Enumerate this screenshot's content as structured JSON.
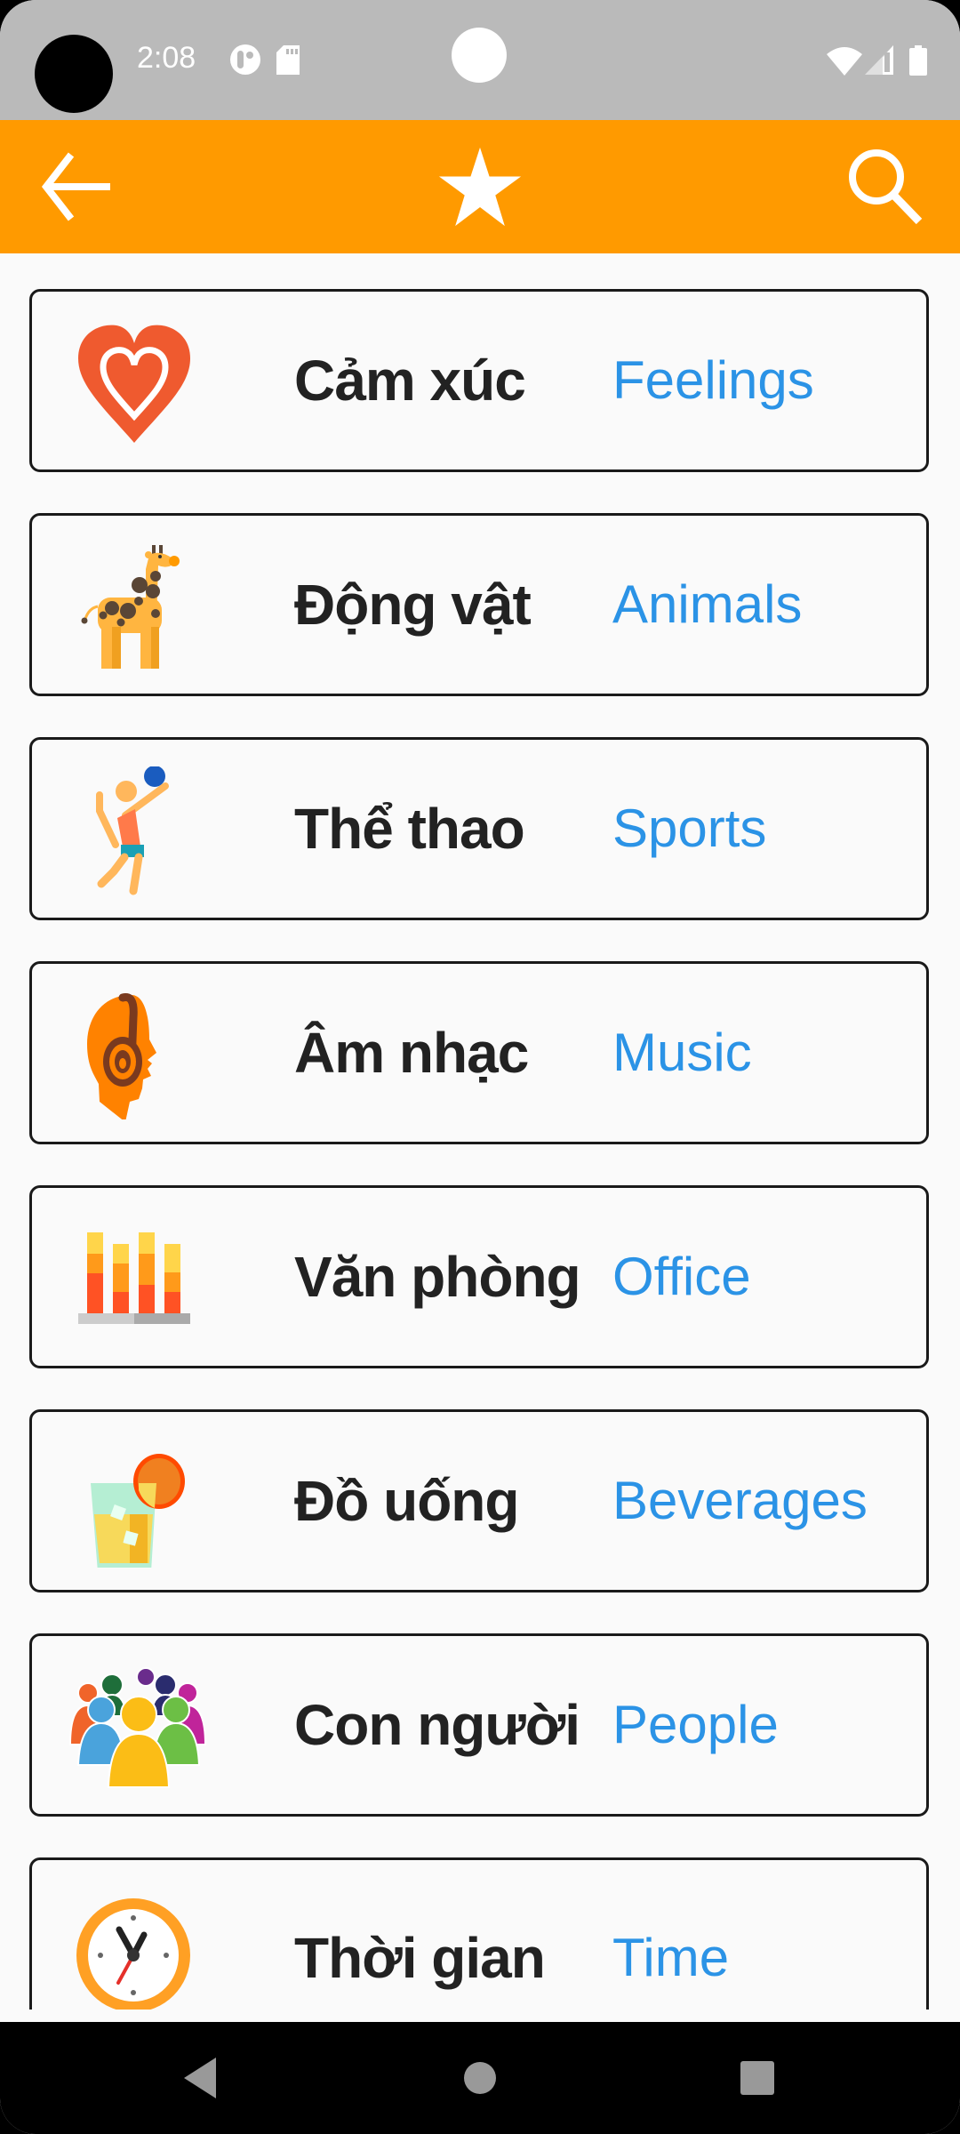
{
  "status_bar": {
    "time": "2:08",
    "left_icons": [
      "notification-app-icon",
      "sd-card-icon"
    ],
    "right_icons": [
      "wifi-icon",
      "cell-signal-icon",
      "battery-icon"
    ]
  },
  "app_bar": {
    "back_icon": "arrow-left-icon",
    "center_icon": "star-icon",
    "search_icon": "search-icon",
    "background_color": "#ff9a00"
  },
  "categories": [
    {
      "vi": "Cảm xúc",
      "en": "Feelings",
      "icon": "heart-icon"
    },
    {
      "vi": "Động vật",
      "en": "Animals",
      "icon": "giraffe-icon"
    },
    {
      "vi": "Thể thao",
      "en": "Sports",
      "icon": "volleyball-player-icon"
    },
    {
      "vi": "Âm nhạc",
      "en": "Music",
      "icon": "headphones-head-icon"
    },
    {
      "vi": "Văn phòng",
      "en": "Office",
      "icon": "bar-chart-icon"
    },
    {
      "vi": "Đồ uống",
      "en": "Beverages",
      "icon": "drink-glass-icon"
    },
    {
      "vi": "Con người",
      "en": "People",
      "icon": "people-group-icon"
    },
    {
      "vi": "Thời gian",
      "en": "Time",
      "icon": "clock-icon"
    }
  ],
  "colors": {
    "accent": "#ff9a00",
    "english_label": "#2b93e6",
    "vietnamese_label": "#222222"
  },
  "nav_bar": {
    "back": "nav-back-icon",
    "home": "nav-home-icon",
    "recents": "nav-recents-icon"
  }
}
